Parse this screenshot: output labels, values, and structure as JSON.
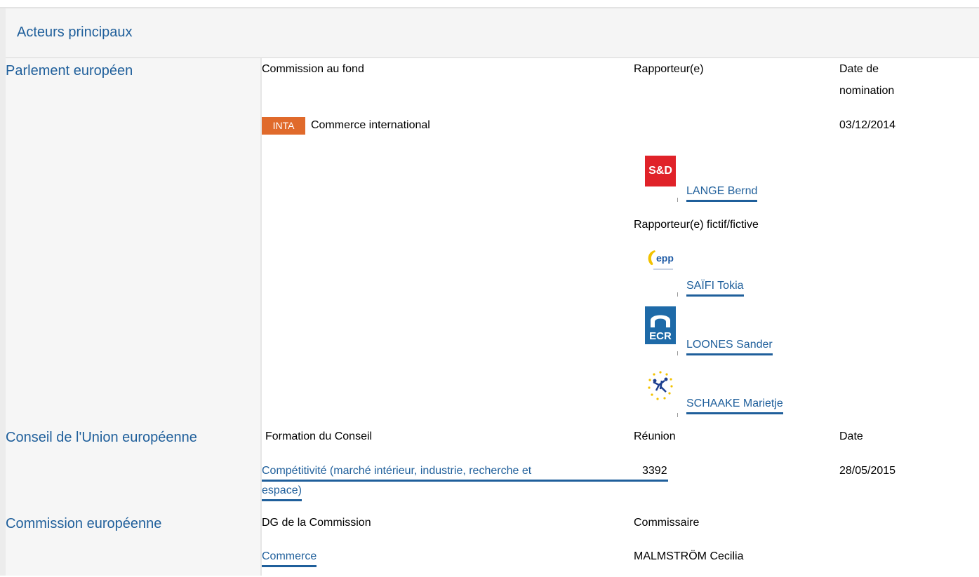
{
  "section_title": "Acteurs principaux",
  "parliament": {
    "institution": "Parlement européen",
    "col_committee": "Commission au fond",
    "col_rapporteur": "Rapporteur(e)",
    "col_date_line1": "Date de",
    "col_date_line2": "nomination",
    "committee_badge": "INTA",
    "committee_name": "Commerce international",
    "committee_date": "03/12/2014",
    "rapporteur": {
      "group_logo": "S&D",
      "name": "LANGE Bernd"
    },
    "shadow_label": "Rapporteur(e) fictif/fictive",
    "shadows": [
      {
        "group_logo": "epp",
        "name": "SAÏFI Tokia"
      },
      {
        "group_logo": "ECR",
        "name": "LOONES Sander"
      },
      {
        "group_logo": "alde-stars",
        "name": "SCHAAKE Marietje"
      }
    ]
  },
  "council": {
    "institution": "Conseil de l'Union européenne",
    "col_formation": "Formation du Conseil",
    "col_meeting": "Réunion",
    "col_date": "Date",
    "formation_line1": "Compétitivité (marché intérieur, industrie, recherche et",
    "formation_line2": "espace)",
    "meeting": "3392",
    "date": "28/05/2015"
  },
  "commission": {
    "institution": "Commission européenne",
    "col_dg": "DG de la Commission",
    "col_commissioner": "Commissaire",
    "dg": "Commerce",
    "commissioner": "MALMSTRÖM Cecilia"
  },
  "colors": {
    "link": "#1f5f9b",
    "inta_badge": "#e06a2b",
    "sd": "#e02229",
    "ecr": "#1e6aa8"
  }
}
